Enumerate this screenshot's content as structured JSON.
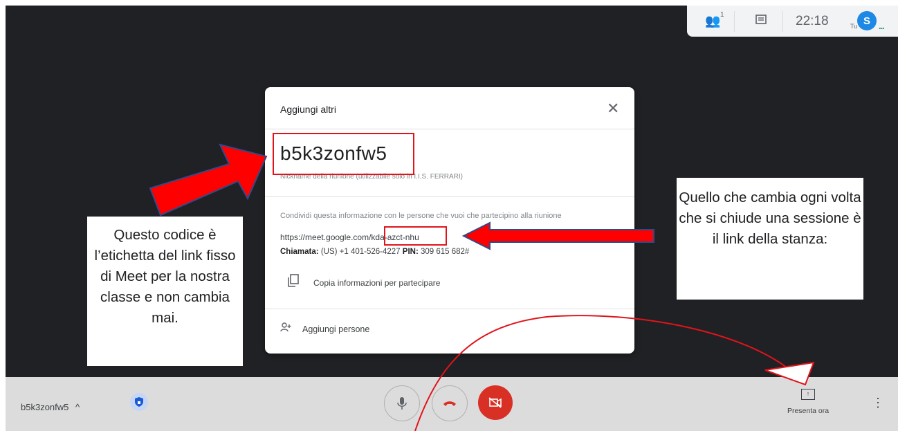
{
  "topbar": {
    "participants_icon": "people-icon",
    "participant_count": "1",
    "chat_icon": "chat-icon",
    "clock": "22:18",
    "self_label": "Tu",
    "avatar_initial": "S",
    "more": "..."
  },
  "dialog": {
    "title": "Aggiungi altri",
    "close": "✕",
    "meeting_nickname": "b5k3zonfw5",
    "nickname_caption": "Nickname della riunione (utilizzabile solo in I.I.S. FERRARI)",
    "share_text": "Condividi questa informazione con le persone che vuoi che partecipino alla riunione",
    "link_prefix": "https://meet.google.com/",
    "link_code": "kda-azct-nhu",
    "call_label": "Chiamata:",
    "call_number": "(US) +1 401-526-4227",
    "pin_label": "PIN:",
    "pin_value": "309 615 682#",
    "copy_label": "Copia informazioni per partecipare",
    "add_label": "Aggiungi persone"
  },
  "bottombar": {
    "meeting_code": "b5k3zonfw5",
    "chevron": "^",
    "present_label": "Presenta ora",
    "more": "⋮"
  },
  "annotations": {
    "left_text": "Questo codice è l’etichetta del link fisso di Meet per la nostra classe e non cambia mai.",
    "right_text": "Quello che cambia ogni volta che si chiude una sessione è il link della stanza:"
  },
  "colors": {
    "background": "#202124",
    "highlight": "#e0141b",
    "arrow_fill": "#ff0000",
    "arrow_border": "#2f4a8a",
    "hangup": "#d93025",
    "avatar": "#1e88e5"
  }
}
